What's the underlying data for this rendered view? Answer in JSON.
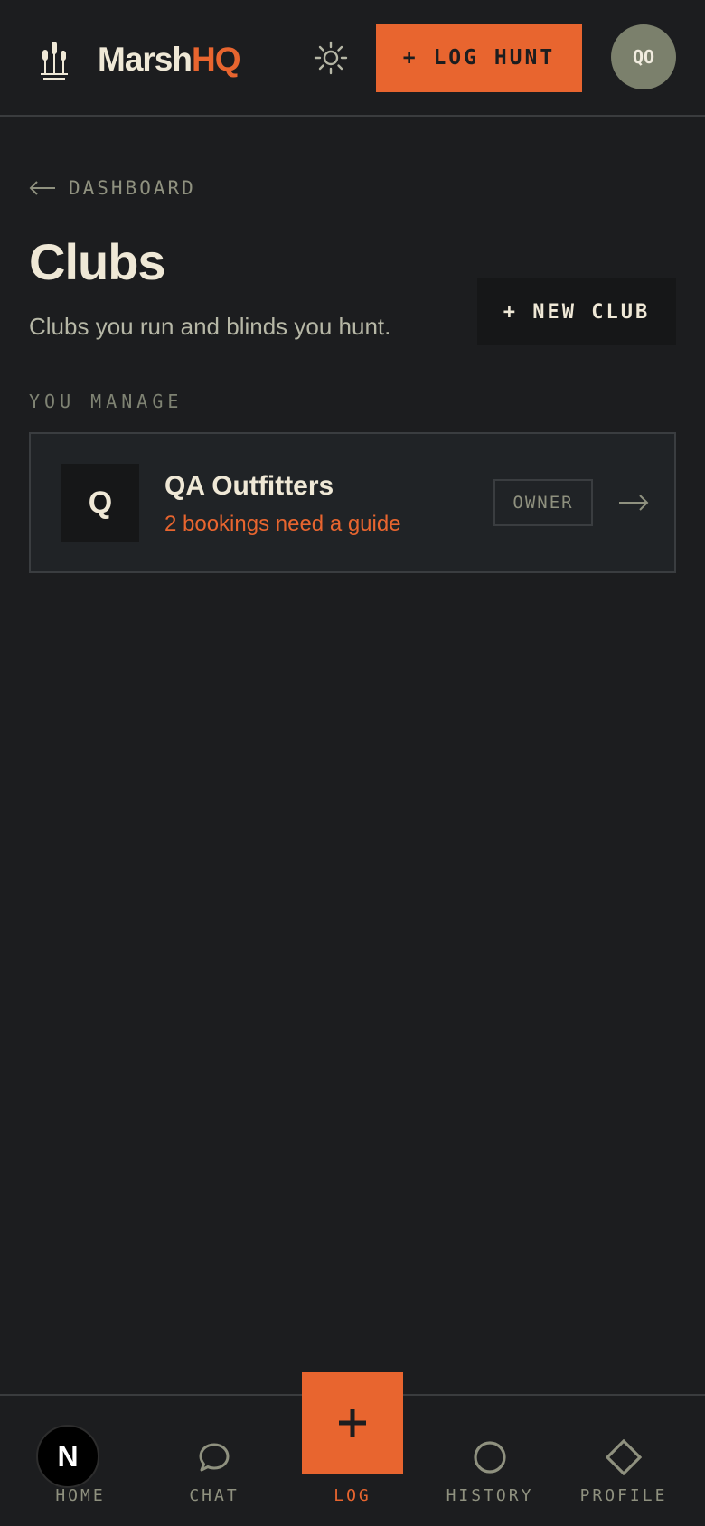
{
  "header": {
    "brand_part1": "Marsh",
    "brand_part2": "HQ",
    "log_button": "+ LOG HUNT",
    "avatar_initials": "QO"
  },
  "nav_back": {
    "label": "DASHBOARD"
  },
  "page": {
    "title": "Clubs",
    "subtitle": "Clubs you run and blinds you hunt.",
    "new_club_button": "+ NEW CLUB"
  },
  "manage_section": {
    "label": "YOU MANAGE",
    "clubs": [
      {
        "initial": "Q",
        "name": "QA Outfitters",
        "status": "2 bookings need a guide",
        "role": "OWNER"
      }
    ]
  },
  "bottom_nav": {
    "items": [
      {
        "label": "HOME",
        "icon": "home-icon"
      },
      {
        "label": "CHAT",
        "icon": "chat-bubble-icon"
      },
      {
        "label": "LOG",
        "icon": "plus-icon"
      },
      {
        "label": "HISTORY",
        "icon": "circle-icon"
      },
      {
        "label": "PROFILE",
        "icon": "diamond-icon"
      }
    ]
  },
  "dev_badge": {
    "letter": "N"
  },
  "colors": {
    "accent": "#e8652f",
    "background": "#1c1d1f",
    "card": "#202326",
    "text": "#efe8d6",
    "muted": "#8f917f"
  }
}
